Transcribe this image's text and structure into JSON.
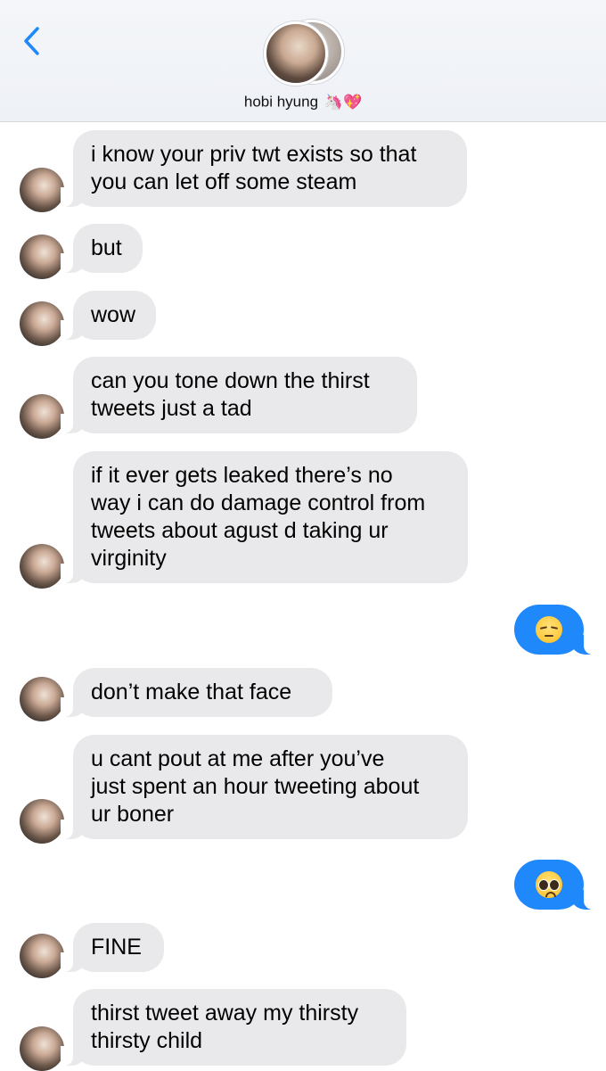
{
  "header": {
    "contact_name": "hobi hyung",
    "name_emoji": "🦄💖",
    "back_icon": "chevron-left-icon"
  },
  "colors": {
    "received_bubble": "#e9e9eb",
    "sent_bubble": "#1f88fa",
    "accent": "#1f88fa"
  },
  "messages": [
    {
      "lines": [
        "i know your priv twt exists so that",
        "you can let off some steam"
      ]
    },
    {
      "lines": [
        "but"
      ]
    },
    {
      "lines": [
        "wow"
      ]
    },
    {
      "lines": [
        "can you tone down the thirst",
        "tweets just a tad"
      ]
    },
    {
      "lines": [
        "if it ever gets leaked there’s no",
        "way i can do damage control from",
        "tweets about agust d taking ur",
        "virginity"
      ]
    },
    {
      "emoji": "pensive-face"
    },
    {
      "lines": [
        "don’t make that face"
      ]
    },
    {
      "lines": [
        "u cant pout at me after you’ve",
        "just spent an hour tweeting about",
        "ur boner"
      ]
    },
    {
      "emoji": "pleading-face"
    },
    {
      "lines": [
        "FINE"
      ]
    },
    {
      "lines": [
        "thirst tweet away my thirsty",
        "thirsty child"
      ]
    }
  ]
}
